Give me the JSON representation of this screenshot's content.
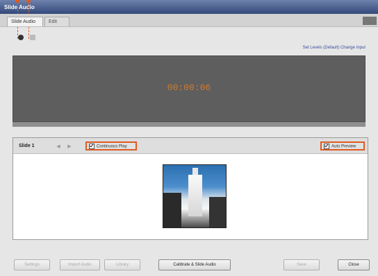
{
  "window": {
    "title": "Slide Audio"
  },
  "tabs": [
    {
      "label": "Slide Audio",
      "active": true
    },
    {
      "label": "Edit",
      "active": false
    }
  ],
  "transport": {
    "record_icon": "record-icon",
    "stop_icon": "stop-icon"
  },
  "header_link": "Set Levels (Default) Change Input",
  "timer": "00:00:06",
  "progress": 1.0,
  "slide_panel": {
    "slide_label": "Slide 1",
    "prev_icon": "chevron-left-icon",
    "next_icon": "chevron-right-icon",
    "continuous_play_label": "Continuous Play",
    "auto_preview_label": "Auto Preview",
    "continuous_play_checked": true,
    "auto_preview_checked": true
  },
  "footer": {
    "buttons": [
      {
        "label": "Settings",
        "enabled": false
      },
      {
        "label": "Import Audio",
        "enabled": false
      },
      {
        "label": "Library",
        "enabled": false
      },
      {
        "label": "Calibrate & Slide Audio",
        "enabled": true
      },
      {
        "label": "Save",
        "enabled": false
      },
      {
        "label": "Close",
        "enabled": true
      }
    ]
  },
  "colors": {
    "accent": "#e05a1f",
    "timer": "#d47a2a",
    "display_bg": "#5e5e5e",
    "titlebar": "#34497a"
  }
}
